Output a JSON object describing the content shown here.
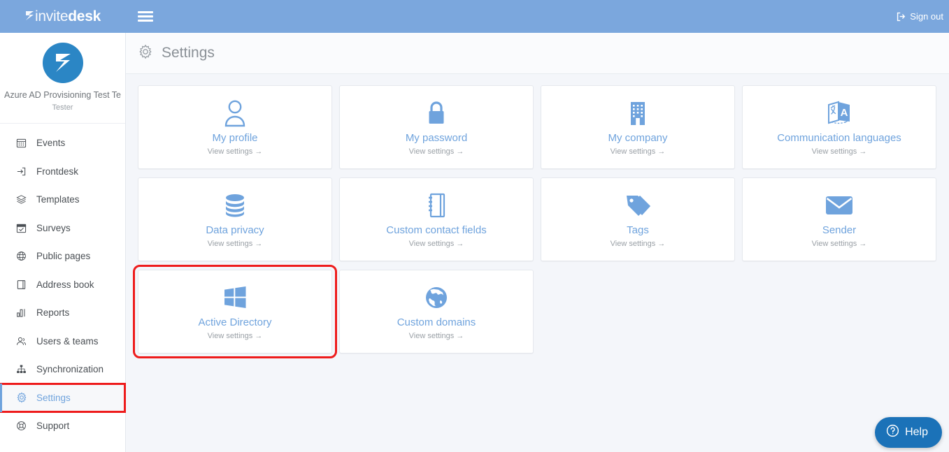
{
  "topbar": {
    "brand_light": "invite",
    "brand_bold": "desk",
    "menu_icon": "hamburger-icon",
    "signout_label": "Sign out",
    "signout_icon": "sign-out-icon",
    "background_color": "#7ba7dd"
  },
  "sidebar": {
    "org_name": "Azure AD Provisioning Test Team",
    "org_role": "Tester",
    "avatar_icon": "invitedesk-logo-icon",
    "items": [
      {
        "label": "Events",
        "icon": "calendar-icon",
        "active": false,
        "highlight": false
      },
      {
        "label": "Frontdesk",
        "icon": "login-arrow-icon",
        "active": false,
        "highlight": false
      },
      {
        "label": "Templates",
        "icon": "layers-icon",
        "active": false,
        "highlight": false
      },
      {
        "label": "Surveys",
        "icon": "calendar-check-icon",
        "active": false,
        "highlight": false
      },
      {
        "label": "Public pages",
        "icon": "globe-icon",
        "active": false,
        "highlight": false
      },
      {
        "label": "Address book",
        "icon": "book-icon",
        "active": false,
        "highlight": false
      },
      {
        "label": "Reports",
        "icon": "bar-chart-icon",
        "active": false,
        "highlight": false
      },
      {
        "label": "Users & teams",
        "icon": "users-icon",
        "active": false,
        "highlight": false
      },
      {
        "label": "Synchronization",
        "icon": "sitemap-icon",
        "active": false,
        "highlight": false
      },
      {
        "label": "Settings",
        "icon": "gear-icon",
        "active": true,
        "highlight": true
      },
      {
        "label": "Support",
        "icon": "lifebuoy-icon",
        "active": false,
        "highlight": false
      }
    ]
  },
  "main": {
    "page_title": "Settings",
    "page_title_icon": "gear-icon",
    "card_link_label": "View settings →",
    "accent_color": "#6fa3dd",
    "highlight_color": "#ee1c1c",
    "cards": [
      {
        "title": "My profile",
        "sub": "View settings →",
        "icon": "user-icon",
        "highlight": false
      },
      {
        "title": "My password",
        "sub": "View settings →",
        "icon": "lock-icon",
        "highlight": false
      },
      {
        "title": "My company",
        "sub": "View settings →",
        "icon": "building-icon",
        "highlight": false
      },
      {
        "title": "Communication languages",
        "sub": "View settings →",
        "icon": "translate-icon",
        "highlight": false
      },
      {
        "title": "Data privacy",
        "sub": "View settings →",
        "icon": "database-icon",
        "highlight": false
      },
      {
        "title": "Custom contact fields",
        "sub": "View settings →",
        "icon": "notebook-icon",
        "highlight": false
      },
      {
        "title": "Tags",
        "sub": "View settings →",
        "icon": "tags-icon",
        "highlight": false
      },
      {
        "title": "Sender",
        "sub": "View settings →",
        "icon": "envelope-icon",
        "highlight": false
      },
      {
        "title": "Active Directory",
        "sub": "View settings →",
        "icon": "windows-icon",
        "highlight": true
      },
      {
        "title": "Custom domains",
        "sub": "View settings →",
        "icon": "globe-americas-icon",
        "highlight": false
      }
    ]
  },
  "help_widget": {
    "label": "Help",
    "icon": "question-circle-icon",
    "color": "#1b72b8"
  }
}
